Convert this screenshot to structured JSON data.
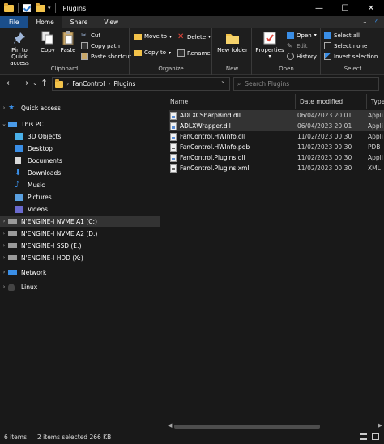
{
  "window": {
    "title": "Plugins",
    "minimize": "—",
    "maximize": "☐",
    "close": "✕"
  },
  "tabs": [
    {
      "label": "File"
    },
    {
      "label": "Home"
    },
    {
      "label": "Share"
    },
    {
      "label": "View"
    }
  ],
  "ribbon": {
    "clipboard": {
      "label": "Clipboard",
      "pin": "Pin to Quick access",
      "copy": "Copy",
      "paste": "Paste",
      "cut": "Cut",
      "copy_path": "Copy path",
      "paste_shortcut": "Paste shortcut"
    },
    "organize": {
      "label": "Organize",
      "move_to": "Move to",
      "copy_to": "Copy to",
      "delete": "Delete",
      "rename": "Rename"
    },
    "new": {
      "label": "New",
      "new_folder": "New folder"
    },
    "open": {
      "label": "Open",
      "properties": "Properties",
      "open": "Open",
      "edit": "Edit",
      "history": "History"
    },
    "select": {
      "label": "Select",
      "select_all": "Select all",
      "select_none": "Select none",
      "invert": "Invert selection"
    }
  },
  "address": {
    "crumbs": [
      "FanControl",
      "Plugins"
    ],
    "search_placeholder": "Search Plugins"
  },
  "nav": {
    "quick_access": "Quick access",
    "this_pc": "This PC",
    "items": [
      {
        "label": "3D Objects"
      },
      {
        "label": "Desktop"
      },
      {
        "label": "Documents"
      },
      {
        "label": "Downloads"
      },
      {
        "label": "Music"
      },
      {
        "label": "Pictures"
      },
      {
        "label": "Videos"
      }
    ],
    "drives": [
      {
        "label": "N'ENGINE-I NVME A1 (C:)"
      },
      {
        "label": "N'ENGINE-I NVME A2 (D:)"
      },
      {
        "label": "N'ENGINE-I SSD (E:)"
      },
      {
        "label": "N'ENGINE-I HDD (X:)"
      }
    ],
    "network": "Network",
    "linux": "Linux"
  },
  "columns": {
    "name": "Name",
    "date": "Date modified",
    "type": "Type"
  },
  "files": [
    {
      "name": "ADLXCSharpBind.dll",
      "date": "06/04/2023 20:01",
      "type": "Appli"
    },
    {
      "name": "ADLXWrapper.dll",
      "date": "06/04/2023 20:01",
      "type": "Appli"
    },
    {
      "name": "FanControl.HWInfo.dll",
      "date": "11/02/2023 00:30",
      "type": "Appli"
    },
    {
      "name": "FanControl.HWInfo.pdb",
      "date": "11/02/2023 00:30",
      "type": "PDB"
    },
    {
      "name": "FanControl.Plugins.dll",
      "date": "11/02/2023 00:30",
      "type": "Appli"
    },
    {
      "name": "FanControl.Plugins.xml",
      "date": "11/02/2023 00:30",
      "type": "XML"
    }
  ],
  "status": {
    "count": "6 items",
    "selection": "2 items selected  266 KB"
  }
}
